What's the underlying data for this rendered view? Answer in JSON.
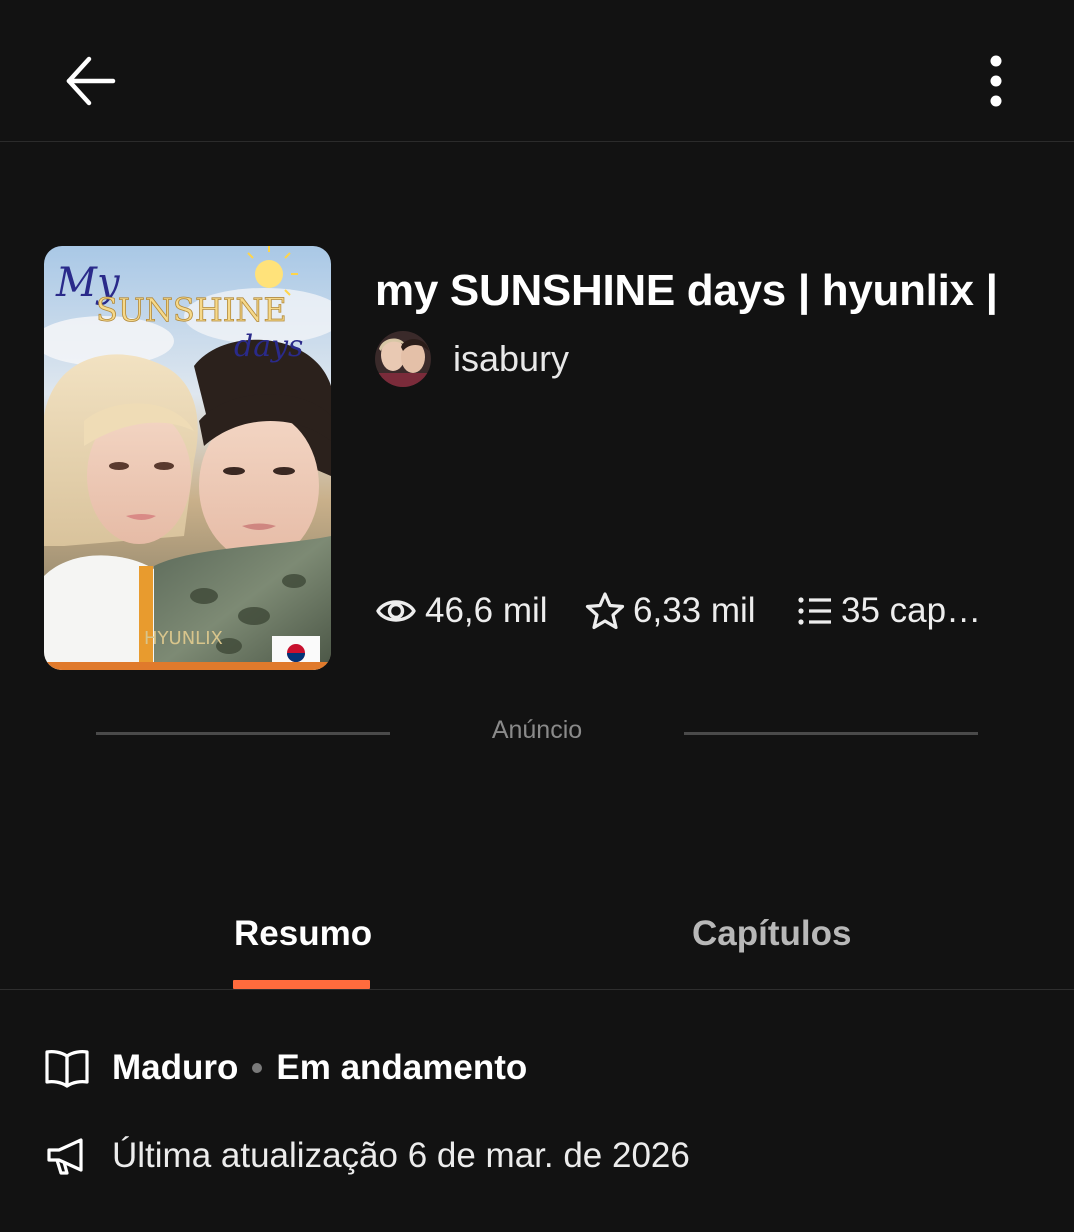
{
  "header": {
    "back_icon": "arrow-left-icon",
    "more_icon": "more-vertical-icon"
  },
  "story": {
    "title": "my SUNSHINE days | hyunlix |",
    "author": "isabury",
    "cover_title_script": "My",
    "cover_title_main": "SUNSHINE",
    "cover_title_sub": "days",
    "cover_footer": "HYUNLIX"
  },
  "stats": {
    "views": "46,6 mil",
    "votes": "6,33 mil",
    "parts": "35 cap…"
  },
  "ad": {
    "label": "Anúncio"
  },
  "tabs": [
    {
      "label": "Resumo",
      "active": true
    },
    {
      "label": "Capítulos",
      "active": false
    }
  ],
  "details": {
    "rating": "Maduro",
    "status": "Em andamento",
    "last_update": "Última atualização 6 de mar. de 2026"
  },
  "colors": {
    "background": "#121212",
    "accent": "#ff6b3d"
  }
}
